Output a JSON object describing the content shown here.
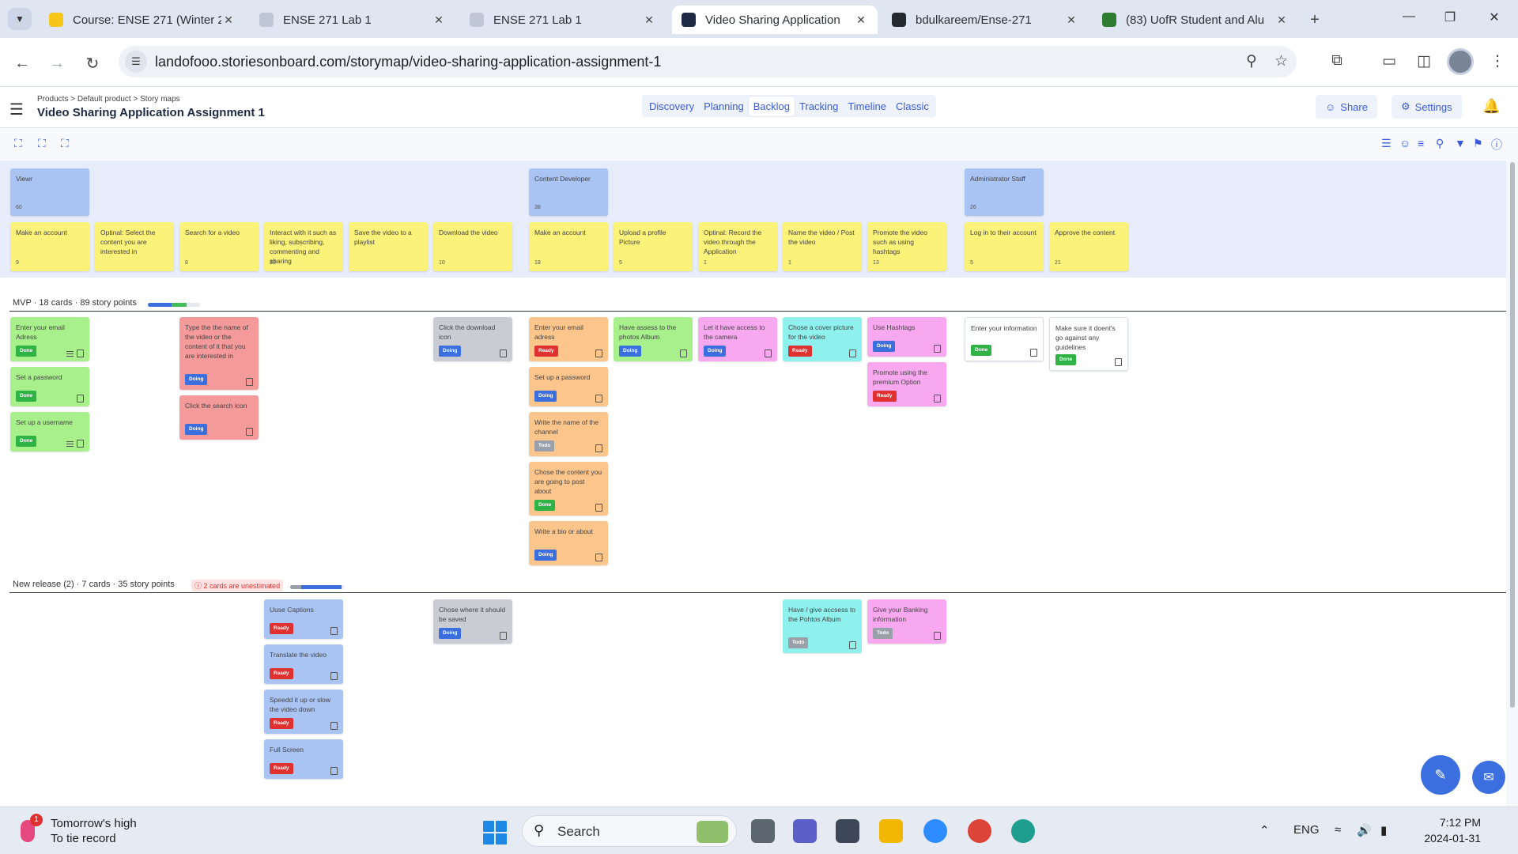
{
  "browser": {
    "tabs": [
      {
        "label": "Course: ENSE 271 (Winter 2",
        "favicon_color": "#f5c518",
        "active": false
      },
      {
        "label": "ENSE 271 Lab 1",
        "favicon_color": "#bfc7d5",
        "active": false
      },
      {
        "label": "ENSE 271 Lab 1",
        "favicon_color": "#bfc7d5",
        "active": false
      },
      {
        "label": "Video Sharing Application",
        "favicon_color": "#1f2a44",
        "active": true
      },
      {
        "label": "bdulkareem/Ense-271",
        "favicon_color": "#24292f",
        "active": false
      },
      {
        "label": "(83) UofR Student and Alu",
        "favicon_color": "#2f7d32",
        "active": false
      }
    ],
    "url": "landofooo.storiesonboard.com/storymap/video-sharing-application-assignment-1"
  },
  "app": {
    "breadcrumb": "Products > Default product > Story maps",
    "title": "Video Sharing Application Assignment 1",
    "view_tabs": [
      "Discovery",
      "Planning",
      "Backlog",
      "Tracking",
      "Timeline",
      "Classic"
    ],
    "active_view": "Backlog",
    "share_label": "Share",
    "settings_label": "Settings"
  },
  "personas": [
    {
      "label": "Viewr",
      "points": "60"
    },
    {
      "label": "Content Developer",
      "points": "38"
    },
    {
      "label": "Administrator Staff",
      "points": "26"
    }
  ],
  "steps": [
    {
      "label": "Make an account",
      "points": "9"
    },
    {
      "label": "Optinal: Select the content you are interested in",
      "points": ""
    },
    {
      "label": "Search for a video",
      "points": "8"
    },
    {
      "label": "Interact with it such as liking, subscribing, commenting and sharing",
      "points": "33"
    },
    {
      "label": "Save the video to a playlist",
      "points": ""
    },
    {
      "label": "Download the video",
      "points": "10"
    },
    {
      "label": "Make an account",
      "points": "18"
    },
    {
      "label": "Upload a profile Picture",
      "points": "5"
    },
    {
      "label": "Optinal: Record the video through the Application",
      "points": "1"
    },
    {
      "label": "Name the video / Post the video",
      "points": "1"
    },
    {
      "label": "Promote the video such as using hashtags",
      "points": "13"
    },
    {
      "label": "Log in to their account",
      "points": "5"
    },
    {
      "label": "Approve the content",
      "points": "21"
    }
  ],
  "releases": {
    "mvp": {
      "label": "MVP · 18 cards · 89 story points",
      "progress_done": 0.45,
      "progress_doing": 0.3,
      "cards": [
        {
          "text": "Enter your email Adress",
          "status": "Done",
          "color": "green",
          "col": 0,
          "row": 0
        },
        {
          "text": "Set a password",
          "status": "Done",
          "color": "green",
          "col": 0,
          "row": 1
        },
        {
          "text": "Set up a username",
          "status": "Done",
          "color": "green",
          "col": 0,
          "row": 2
        },
        {
          "text": "Type the the name of the video or the content of it that you are interested in",
          "status": "Doing",
          "color": "red",
          "col": 2,
          "row": 0
        },
        {
          "text": "Click the search icon",
          "status": "Doing",
          "color": "red",
          "col": 2,
          "row": 1
        },
        {
          "text": "Click the download icon",
          "status": "Doing",
          "color": "gray",
          "col": 5,
          "row": 0
        },
        {
          "text": "Enter your email adress",
          "status": "Ready",
          "color": "orange",
          "col": 6,
          "row": 0
        },
        {
          "text": "Set up a password",
          "status": "Doing",
          "color": "orange",
          "col": 6,
          "row": 1
        },
        {
          "text": "Write the name of the channel",
          "status": "Todo",
          "color": "orange",
          "col": 6,
          "row": 2
        },
        {
          "text": "Chose the content you are going to post about",
          "status": "Done",
          "color": "orange",
          "col": 6,
          "row": 3
        },
        {
          "text": "Write a bio or about",
          "status": "Doing",
          "color": "orange",
          "col": 6,
          "row": 4
        },
        {
          "text": "Have assess to the photos Album",
          "status": "Doing",
          "color": "green",
          "col": 7,
          "row": 0
        },
        {
          "text": "Let it have access to the camera",
          "status": "Doing",
          "color": "pink",
          "col": 8,
          "row": 0
        },
        {
          "text": "Chose a cover picture for the video",
          "status": "Ready",
          "color": "cyan",
          "col": 9,
          "row": 0
        },
        {
          "text": "Use Hashtags",
          "status": "Doing",
          "color": "pink",
          "col": 10,
          "row": 0
        },
        {
          "text": "Promote using the premium Option",
          "status": "Ready",
          "color": "pink",
          "col": 10,
          "row": 1
        },
        {
          "text": "Enter your information",
          "status": "Done",
          "color": "white",
          "col": 11,
          "row": 0
        },
        {
          "text": "Make sure it doent's go against any guidelines",
          "status": "Done",
          "color": "white",
          "col": 12,
          "row": 0
        }
      ]
    },
    "new_release": {
      "label": "New release (2) · 7 cards · 35 story points",
      "unestimated": "2 cards are unestimated",
      "progress_done": 0.0,
      "progress_doing": 0.75,
      "cards": [
        {
          "text": "Uuse Captions",
          "status": "Ready",
          "color": "blue",
          "col": 3,
          "row": 0
        },
        {
          "text": "Translate the video",
          "status": "Ready",
          "color": "blue",
          "col": 3,
          "row": 1
        },
        {
          "text": "Speedd it up or slow the video down",
          "status": "Ready",
          "color": "blue",
          "col": 3,
          "row": 2
        },
        {
          "text": "Full Screen",
          "status": "Ready",
          "color": "blue",
          "col": 3,
          "row": 3
        },
        {
          "text": "Chose where it should be saved",
          "status": "Doing",
          "color": "gray",
          "col": 5,
          "row": 0
        },
        {
          "text": "Have / give accsess to the Pohtos Album",
          "status": "Todo",
          "color": "cyan",
          "col": 9,
          "row": 0
        },
        {
          "text": "Give your Banking information",
          "status": "Todo",
          "color": "pink",
          "col": 10,
          "row": 0
        }
      ]
    }
  },
  "taskbar": {
    "weather_line1": "Tomorrow's high",
    "weather_line2": "To tie record",
    "weather_badge": "1",
    "search_label": "Search",
    "lang": "ENG",
    "time": "7:12 PM",
    "date": "2024-01-31"
  }
}
